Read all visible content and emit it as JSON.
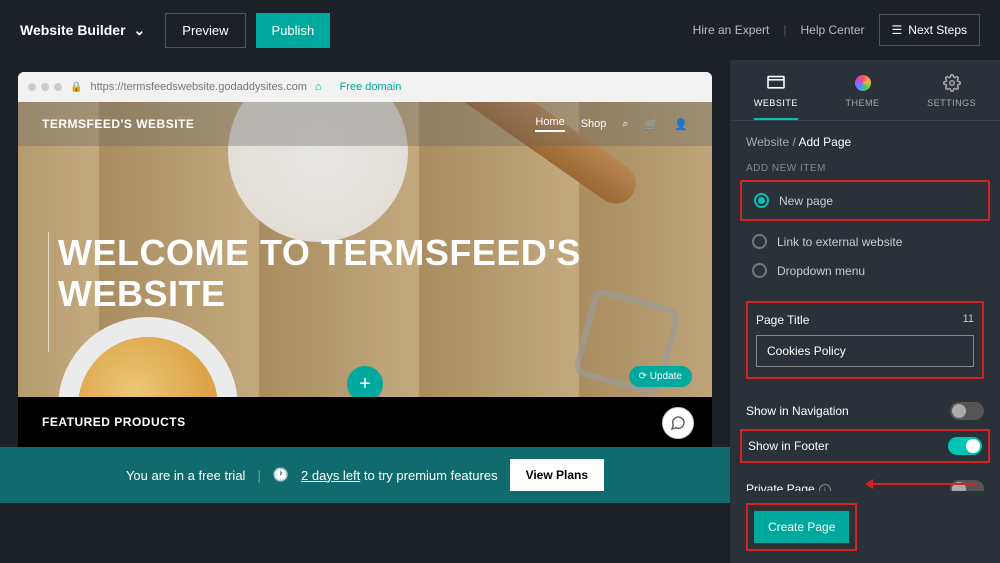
{
  "brand": "Website Builder",
  "top": {
    "preview": "Preview",
    "publish": "Publish",
    "hire": "Hire an Expert",
    "help": "Help Center",
    "next": "Next Steps"
  },
  "browser": {
    "url": "https://termsfeedswebsite.godaddysites.com",
    "free": "Free domain"
  },
  "site": {
    "name": "TERMSFEED'S WEBSITE",
    "nav": {
      "home": "Home",
      "shop": "Shop"
    },
    "hero1": "WELCOME TO TERMSFEED'S",
    "hero2": "WEBSITE",
    "update": "Update",
    "featured": "FEATURED PRODUCTS"
  },
  "trial": {
    "msg": "You are in a free trial",
    "days": "2 days left",
    "rest": "to try premium features",
    "plans": "View Plans"
  },
  "sidebar": {
    "tabs": {
      "website": "WEBSITE",
      "theme": "THEME",
      "settings": "SETTINGS"
    },
    "crumb_root": "Website",
    "crumb_cur": "Add Page",
    "add_label": "ADD NEW ITEM",
    "radios": {
      "new": "New page",
      "link": "Link to external website",
      "dropdown": "Dropdown menu"
    },
    "page_title_label": "Page Title",
    "page_title_count": "11",
    "page_title_value": "Cookies Policy",
    "toggles": {
      "nav": "Show in Navigation",
      "footer": "Show in Footer",
      "private": "Private Page"
    },
    "create": "Create Page"
  }
}
